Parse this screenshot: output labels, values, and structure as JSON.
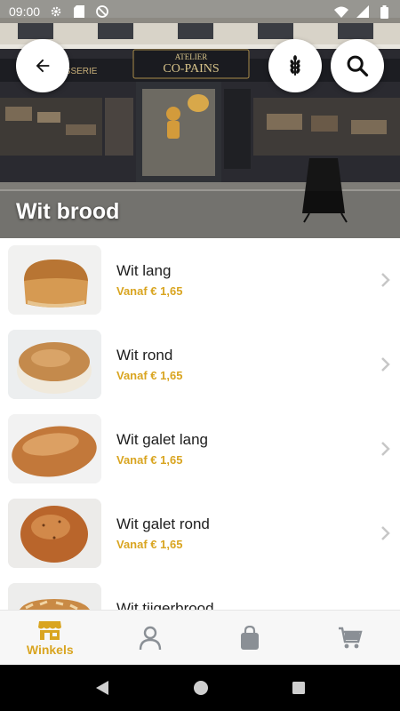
{
  "status_bar": {
    "time": "09:00",
    "icons": [
      "settings-icon",
      "sd-card-icon",
      "do-not-disturb-icon",
      "wifi-icon",
      "signal-icon",
      "battery-icon"
    ]
  },
  "hero": {
    "title": "Wit brood",
    "image": "bakery-storefront-photo"
  },
  "header_buttons": {
    "back": "arrow-left-icon",
    "filter": "wheat-grain-icon",
    "search": "search-icon"
  },
  "products": [
    {
      "name": "Wit lang",
      "price": "Vanaf € 1,65",
      "image": "long-white-bread"
    },
    {
      "name": "Wit rond",
      "price": "Vanaf € 1,65",
      "image": "round-white-bread"
    },
    {
      "name": "Wit galet lang",
      "price": "Vanaf € 1,65",
      "image": "long-galet-bread"
    },
    {
      "name": "Wit galet rond",
      "price": "Vanaf € 1,65",
      "image": "round-galet-bread"
    },
    {
      "name": "Wit tijgerbrood",
      "price": "",
      "image": "tiger-bread"
    }
  ],
  "bottom_nav": {
    "items": [
      {
        "label": "Winkels",
        "icon": "store-icon",
        "active": true
      },
      {
        "label": "",
        "icon": "user-icon",
        "active": false
      },
      {
        "label": "",
        "icon": "shopping-bag-icon",
        "active": false
      },
      {
        "label": "",
        "icon": "cart-icon",
        "active": false
      }
    ]
  },
  "colors": {
    "accent": "#d9a521",
    "inactive_icon": "#8a8f95",
    "chevron": "#c7c7c7"
  }
}
